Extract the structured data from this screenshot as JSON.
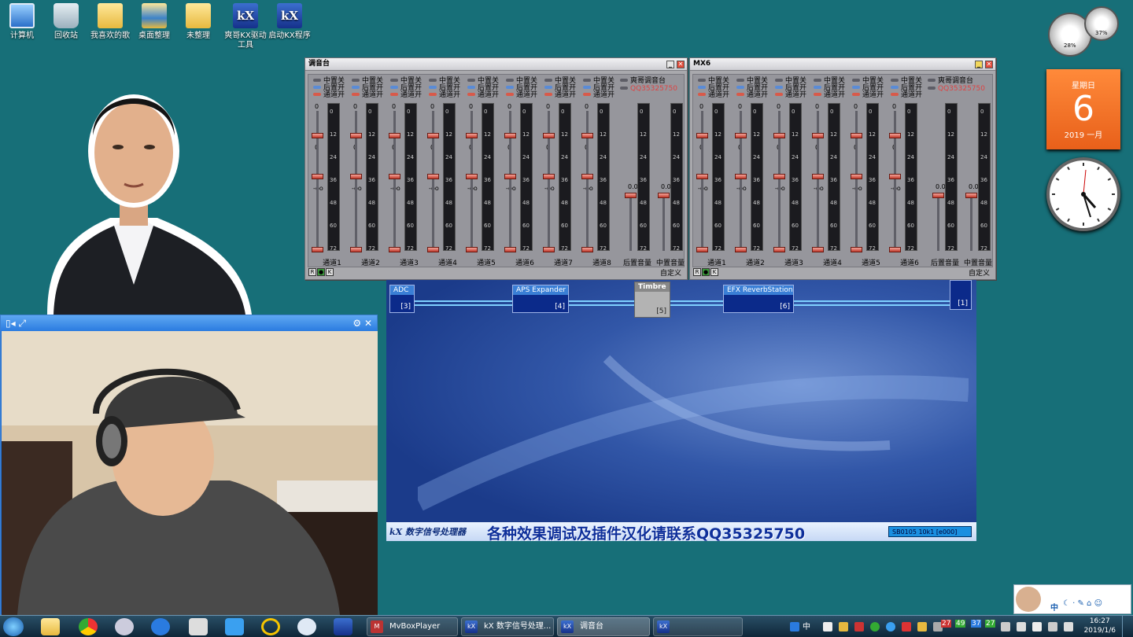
{
  "desktop": {
    "icons": [
      "计算机",
      "回收站",
      "我喜欢的歌",
      "桌面整理",
      "未整理",
      "爽哥KX驱动工具",
      "启动KX程序"
    ]
  },
  "mixer_left": {
    "title": "调音台",
    "switches": [
      "中置关",
      "后置开",
      "通道开"
    ],
    "top_label": "爽哥调音台",
    "qq": "QQ35325750",
    "levels": [
      "0",
      "0",
      "-oo"
    ],
    "channels": [
      "通道1",
      "通道2",
      "通道3",
      "通道4",
      "通道5",
      "通道6",
      "通道7",
      "通道8"
    ],
    "masters": [
      "后置音量",
      "中置音量"
    ],
    "master_value": "0.0",
    "meter_ticks": [
      "0",
      "12",
      "24",
      "36",
      "48",
      "60",
      "72"
    ],
    "footer_buttons": [
      "R",
      "●",
      "K"
    ],
    "custom": "自定义"
  },
  "mixer_right": {
    "title": "MX6",
    "channels": [
      "通道1",
      "通道2",
      "通道3",
      "通道4",
      "通道5",
      "通道6"
    ],
    "masters": [
      "后置音量",
      "中置音量"
    ],
    "custom": "自定义"
  },
  "dsp": {
    "plugins": [
      {
        "name": "ADC",
        "num": "[3]"
      },
      {
        "name": "APS Expander",
        "num": "[4]"
      },
      {
        "name": "Timbre",
        "num": "[5]"
      },
      {
        "name": "EFX ReverbStation",
        "num": "[6]"
      },
      {
        "name": "",
        "num": "[1]"
      }
    ],
    "banner_logo": "kX 数字信号处理器",
    "banner_text": "各种效果调试及插件汉化请联系QQ35325750",
    "version": "SB0105 10k1 [e000]"
  },
  "gadgets": {
    "gauge1": "28%",
    "gauge2": "37%",
    "weekday": "星期日",
    "day": "6",
    "yearmonth": "2019 一月"
  },
  "taskbar": {
    "tasks": [
      "MvBoxPlayer",
      "kX 数字信号处理...",
      "调音台",
      ""
    ],
    "time": "16:27",
    "date": "2019/1/6",
    "ime": "中",
    "tray_numbers": [
      "27",
      "49",
      "37",
      "27"
    ]
  },
  "colors": {
    "desktop": "#176f78",
    "accent": "#2a7be0",
    "fader": "#c0392b"
  }
}
